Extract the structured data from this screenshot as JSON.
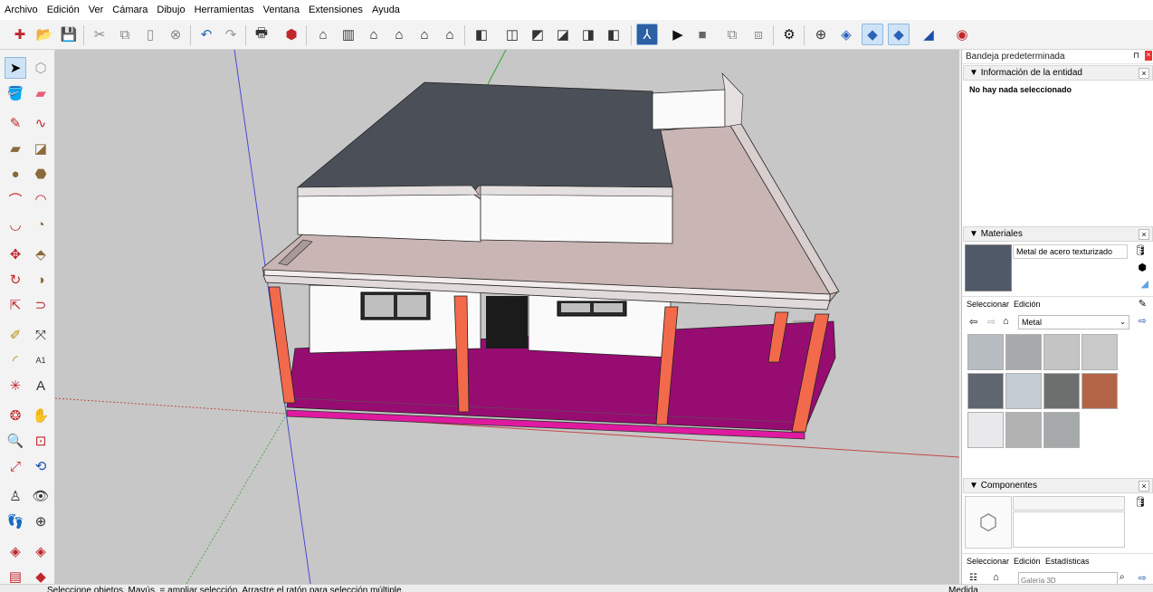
{
  "menu": [
    "Archivo",
    "Edición",
    "Ver",
    "Cámara",
    "Dibujo",
    "Herramientas",
    "Ventana",
    "Extensiones",
    "Ayuda"
  ],
  "tray": {
    "title": "Bandeja predeterminada",
    "entity": {
      "header": "Información de la entidad",
      "message": "No hay nada seleccionado"
    },
    "materials": {
      "header": "Materiales",
      "current_name": "Metal de acero texturizado",
      "tab_select": "Seleccionar",
      "tab_edit": "Edición",
      "collection": "Metal",
      "swatches": [
        "#b6bcc0",
        "#a7a9ab",
        "#c4c4c4",
        "#c9c9c9",
        "#5f6670",
        "#c6ccd4",
        "#6d6e6e",
        "#b46446",
        "#e9e9ec",
        "#b2b2b2",
        "#a6a9aa"
      ]
    },
    "components": {
      "header": "Componentes",
      "tab_select": "Seleccionar",
      "tab_edit": "Edición",
      "tab_stats": "Estadísticas",
      "search_placeholder": "Galería 3D"
    }
  },
  "status": {
    "hint": "Seleccione objetos. Mayús. = ampliar selección. Arrastre el ratón para selección múltiple.",
    "measure_label": "Medida"
  },
  "colors": {
    "roof": "#4b5058",
    "wall": "#ffffff",
    "terrace": "#c9b5b3",
    "floor": "#970c70",
    "column": "#f26a4b",
    "ground": "#c7c7c7"
  }
}
